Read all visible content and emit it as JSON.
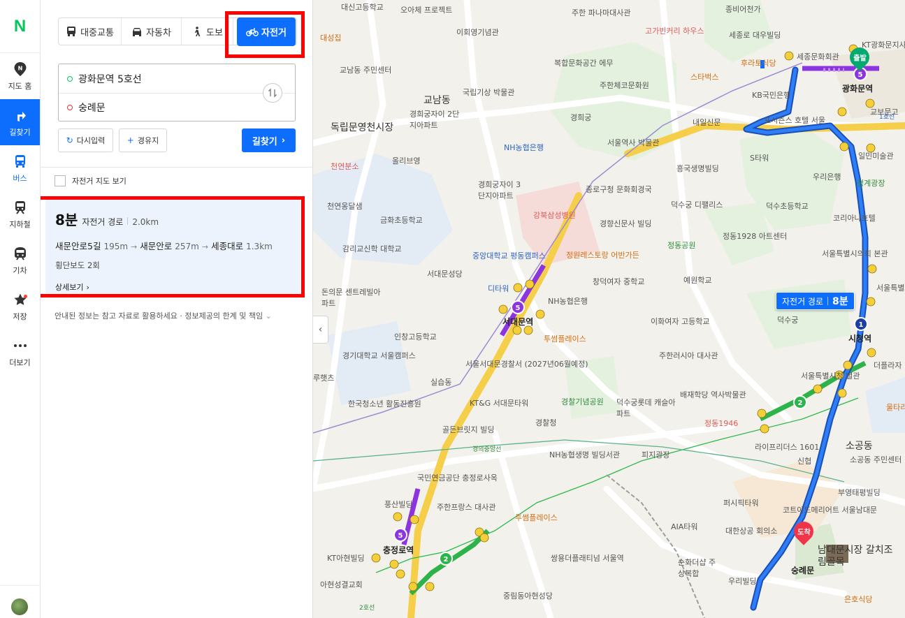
{
  "rail": {
    "logo": "N",
    "items": [
      {
        "label": "지도 홈",
        "icon": "map-home-icon"
      },
      {
        "label": "길찾기",
        "icon": "directions-icon"
      },
      {
        "label": "버스",
        "icon": "bus-icon"
      },
      {
        "label": "지하철",
        "icon": "subway-icon"
      },
      {
        "label": "기차",
        "icon": "train-icon"
      },
      {
        "label": "저장",
        "icon": "star-icon"
      },
      {
        "label": "더보기",
        "icon": "more-icon"
      }
    ]
  },
  "tabs": {
    "transit": "대중교통",
    "car": "자동차",
    "walk": "도보",
    "bike": "자전거"
  },
  "route": {
    "origin": "광화문역 5호선",
    "destination": "숭례문"
  },
  "buttons": {
    "reset": "다시입력",
    "waypoint": "경유지",
    "search": "길찾기"
  },
  "bike_map_toggle": "자전거 지도 보기",
  "result": {
    "minutes": "8분",
    "type": "자전거 경로",
    "distance": "2.0km",
    "segments": [
      {
        "name": "새문안로5길",
        "dist": "195m"
      },
      {
        "name": "새문안로",
        "dist": "257m"
      },
      {
        "name": "세종대로",
        "dist": "1.3km"
      }
    ],
    "crosswalks": "횡단보도 2회",
    "detail": "상세보기"
  },
  "notice": "안내된 정보는 참고 자료로 활용하세요 · 정보제공의 한계 및 책임",
  "map": {
    "badge_type": "자전거 경로",
    "badge_minutes": "8분",
    "start_label": "출발",
    "end_label": "도착",
    "labels": [
      "대신고등학교",
      "오아체 프로젝트",
      "주한 파나마대사관",
      "종비어천가",
      "KT광화문지사",
      "대성집",
      "이회영기념관",
      "고가빈커리 하우스",
      "세종로 대우빌딩",
      "세종문화회관",
      "교남동 주민센터",
      "복합문화공간 에무",
      "후라토식당",
      "국립기상 박물관",
      "주한체코문화원",
      "스타벅스",
      "광화문역",
      "교보문고",
      "KB국민은행",
      "교남동",
      "경희궁자이 2단지아파트",
      "경희궁",
      "내일신문",
      "포시즌스 호텔 서울",
      "독립문영천시장",
      "NH농협은행",
      "서울역사 박물관",
      "S타워",
      "일민미술관",
      "올리브영",
      "천연분소",
      "흥국생명빌딩",
      "우리은행",
      "청계광장",
      "경희궁자이 3단지아파트",
      "종로구청 문화회경국",
      "천연옹달샘",
      "덕수궁 디팰리스",
      "덕수초등학교",
      "코리아나호텔",
      "금화초등학교",
      "강북삼성병원",
      "경향신문사 빌딩",
      "정동1928 아트센터",
      "감리교신학 대학교",
      "중앙대학교 평동캠퍼스",
      "정동공원",
      "서대문성당",
      "정원레스토랑 어반가든",
      "서울특별시의회 본관",
      "돈의문 센트레빌아파트",
      "디타워",
      "창덕여자 중학교",
      "예원학교",
      "서울특별시",
      "서대문역",
      "NH농협은행",
      "덕수궁",
      "시청역",
      "인창고등학교",
      "투썸플레이스",
      "이화여자 고등학교",
      "경기대학교 서울캠퍼스",
      "서울서대문경찰서 (2027년06월예정)",
      "주한러시아 대사관",
      "더플라자",
      "루햇츠",
      "실습동",
      "서울특별시청 별관",
      "배재학당 역사박물관",
      "한국청소년 활동진흥원",
      "KT&G 서대문타워",
      "경찰기념공원",
      "덕수궁롯데 캐슬아파트",
      "울타리",
      "경찰청",
      "정동1946",
      "골든브릿지 빌딩",
      "라이프리더스 1601",
      "소공동",
      "NH농협생명 빌딩서관",
      "피지광장",
      "신협",
      "소공동 주민센터",
      "국민연금공단 충정로사옥",
      "부영태평빌딩",
      "풍산빌딩",
      "주한프랑스 대사관",
      "퍼시픽타워",
      "투썸플레이스",
      "코트야드메리어트 서울남대문",
      "AIA타워",
      "대한상공 회의소",
      "충정로역",
      "KT아현빌딩",
      "쌍용더플래티넘 서울역",
      "순화더샵 주상복합",
      "남대문시장 갈치조림골목",
      "숭례문",
      "아현성결교회",
      "우리빌딩",
      "중림동아현성당",
      "은호식당",
      "경의중앙선",
      "2호선",
      "1호선"
    ]
  }
}
